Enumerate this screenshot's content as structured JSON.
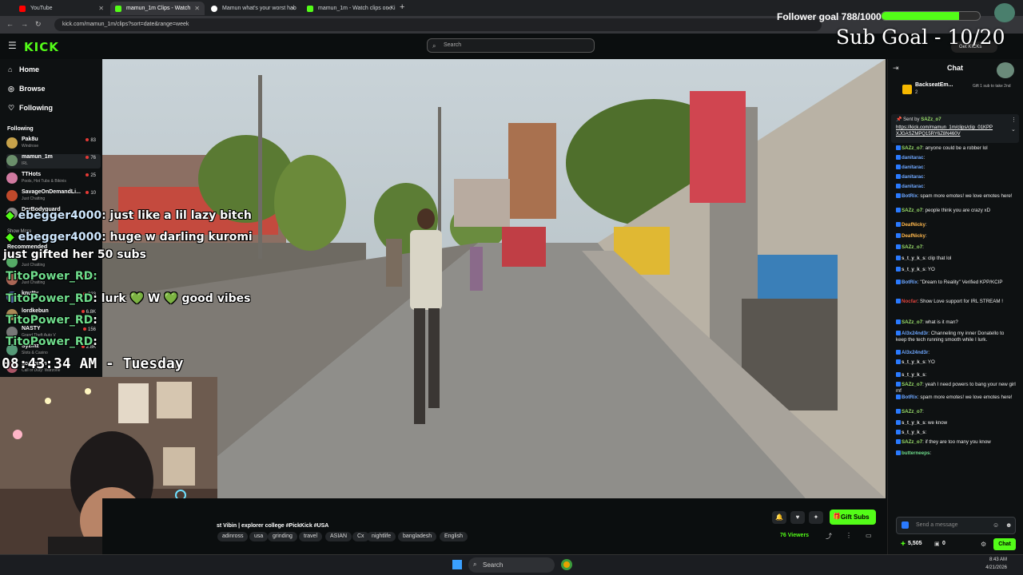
{
  "browser": {
    "tabs": [
      {
        "title": "YouTube",
        "color": "#ff0000"
      },
      {
        "title": "mamun_1m Clips - Watch",
        "color": "#53fc18"
      },
      {
        "title": "Mamun what's your worst hab",
        "color": "#ffffff"
      },
      {
        "title": "mamun_1m - Watch clips on Ki",
        "color": "#53fc18"
      }
    ],
    "url": "kick.com/mamun_1m/clips?sort=date&range=week"
  },
  "header": {
    "logo": "KICK",
    "search_placeholder": "Search",
    "follower_goal": "Follower goal 788/1000",
    "sub_goal": "Sub Goal - 10/20",
    "get_kicks": "Get KICKs"
  },
  "sidebar": {
    "nav": [
      {
        "label": "Home",
        "icon": "home-icon"
      },
      {
        "label": "Browse",
        "icon": "compass-icon"
      },
      {
        "label": "Following",
        "icon": "heart-icon"
      }
    ],
    "following_heading": "Following",
    "following": [
      {
        "name": "Pak8u",
        "sub": "Windrose",
        "count": "83",
        "color": "#c7a24a"
      },
      {
        "name": "mamun_1m",
        "sub": "IRL",
        "count": "76",
        "color": "#6b8f6b"
      },
      {
        "name": "TTHots",
        "sub": "Pools, Hot Tubs & Bikinis",
        "count": "25",
        "color": "#d07aa0"
      },
      {
        "name": "SavageOnDemandLi...",
        "sub": "Just Chatting",
        "count": "10",
        "color": "#c0492b"
      },
      {
        "name": "DerBodyguard",
        "sub": "",
        "count": "",
        "color": "#888"
      }
    ],
    "show_more": "Show More",
    "recommended_heading": "Recommended",
    "recommended": [
      {
        "name": "",
        "sub": "Just Chatting",
        "count": "",
        "color": "#5a6"
      },
      {
        "name": "",
        "sub": "Just Chatting",
        "count": "506",
        "color": "#a65"
      },
      {
        "name": "knutty",
        "sub": "",
        "count": "223",
        "color": "#56a"
      },
      {
        "name": "lordkebun",
        "sub": "",
        "count": "6.8K",
        "color": "#a85"
      },
      {
        "name": "NASTY",
        "sub": "Grand Theft Auto V",
        "count": "156",
        "color": "#777"
      },
      {
        "name": "Syzmz",
        "sub": "Slots & Casino",
        "count": "2.8K",
        "color": "#597"
      },
      {
        "name": "kotohmm",
        "sub": "Call of Duty: Warzone",
        "count": "",
        "color": "#a56"
      }
    ]
  },
  "overlay": {
    "chat": [
      {
        "user": "ebegger4000",
        "text": ": just like a lil lazy bitch"
      },
      {
        "user": "ebegger4000",
        "text": ": huge w darling kuromi"
      },
      {
        "user": "",
        "text": "just gifted her 50 subs"
      },
      {
        "user": "TitoPower_RD",
        "text": ":"
      },
      {
        "user": "TitoPower_RD",
        "text": ": lurk 💚 W 💚 good vibes"
      },
      {
        "user": "TitoPower_RD",
        "text": ":"
      },
      {
        "user": "TitoPower_RD",
        "text": ":"
      }
    ],
    "clock": "08:43:34 AM - Tuesday"
  },
  "stream": {
    "title": "st Vibin | explorer college #PickKick #USA",
    "tags": [
      "adinross",
      "usa",
      "grinding",
      "travel",
      "ASIAN",
      "Cx",
      "nightlife",
      "bangladesh",
      "English"
    ],
    "gift_subs": "Gift Subs",
    "viewers": "76 Viewers"
  },
  "chat": {
    "title": "Chat",
    "pinned_user": "BackseatEm...",
    "pinned_count": "2",
    "gift_prompt": "Gift 1 sub to take 2nd",
    "sent_by": "Sent by",
    "sent_user": "SAZz_o7",
    "link": "https://kick.com/mamun_1m/clips/clip_01KPPXJGASZMPQ15RY6Z8N460V",
    "messages": [
      {
        "user": "SAZz_o7",
        "text": ": anyone could be a robber lol",
        "color": "#9adf6b"
      },
      {
        "user": "danitarac",
        "text": ":",
        "color": "#6fa8ff"
      },
      {
        "user": "danitarac",
        "text": ":",
        "color": "#6fa8ff"
      },
      {
        "user": "danitarac",
        "text": ":",
        "color": "#6fa8ff"
      },
      {
        "user": "danitarac",
        "text": ":",
        "color": "#6fa8ff"
      },
      {
        "user": "BotRix",
        "text": ": spam more emotes! we love emotes here!",
        "color": "#6fa8ff"
      },
      {
        "user": "SAZz_o7",
        "text": ": people think you are crazy xD",
        "color": "#9adf6b"
      },
      {
        "user": "DeafNicky",
        "text": ":",
        "color": "#ffb84d"
      },
      {
        "user": "DeafNicky",
        "text": ":",
        "color": "#ffb84d"
      },
      {
        "user": "SAZz_o7",
        "text": ":",
        "color": "#9adf6b"
      },
      {
        "user": "s_t_y_k_s",
        "text": ": clip that lol",
        "color": "#dddddd"
      },
      {
        "user": "s_t_y_k_s",
        "text": ": YO",
        "color": "#dddddd"
      },
      {
        "user": "BotRix",
        "text": ": \"Dream to Reality\" Verified KPP/KCIP",
        "color": "#6fa8ff"
      },
      {
        "user": "Nocfar",
        "text": ": Show Love support for IRL STREAM !",
        "color": "#e0443e"
      },
      {
        "user": "SAZz_o7",
        "text": ": what is it man?",
        "color": "#9adf6b"
      },
      {
        "user": "Al3x24nd3r",
        "text": ": Channeling my inner Donatello to keep the tech running smooth while I lurk.",
        "color": "#6fa8ff"
      },
      {
        "user": "Al3x24nd3r",
        "text": ":",
        "color": "#6fa8ff"
      },
      {
        "user": "s_t_y_k_s",
        "text": ": YO",
        "color": "#dddddd"
      },
      {
        "user": "s_t_y_k_s",
        "text": ":",
        "color": "#dddddd"
      },
      {
        "user": "SAZz_o7",
        "text": ": yeah I need powers to bang your new girl mf",
        "color": "#9adf6b"
      },
      {
        "user": "BotRix",
        "text": ": spam more emotes! we love emotes here!",
        "color": "#6fa8ff"
      },
      {
        "user": "SAZz_o7",
        "text": ":",
        "color": "#9adf6b"
      },
      {
        "user": "s_t_y_k_s",
        "text": ": we know",
        "color": "#dddddd"
      },
      {
        "user": "s_t_y_k_s",
        "text": ":",
        "color": "#dddddd"
      },
      {
        "user": "SAZz_o7",
        "text": ": if they are too many you know",
        "color": "#9adf6b"
      },
      {
        "user": "butterneeps",
        "text": ":",
        "color": "#6fdc8c"
      }
    ],
    "input_placeholder": "Send a message",
    "points": "5,505",
    "kicks": "0",
    "chat_button": "Chat"
  },
  "taskbar": {
    "search": "Search",
    "time": "8:43 AM",
    "date": "4/21/2026",
    "webcam_count": "3"
  }
}
